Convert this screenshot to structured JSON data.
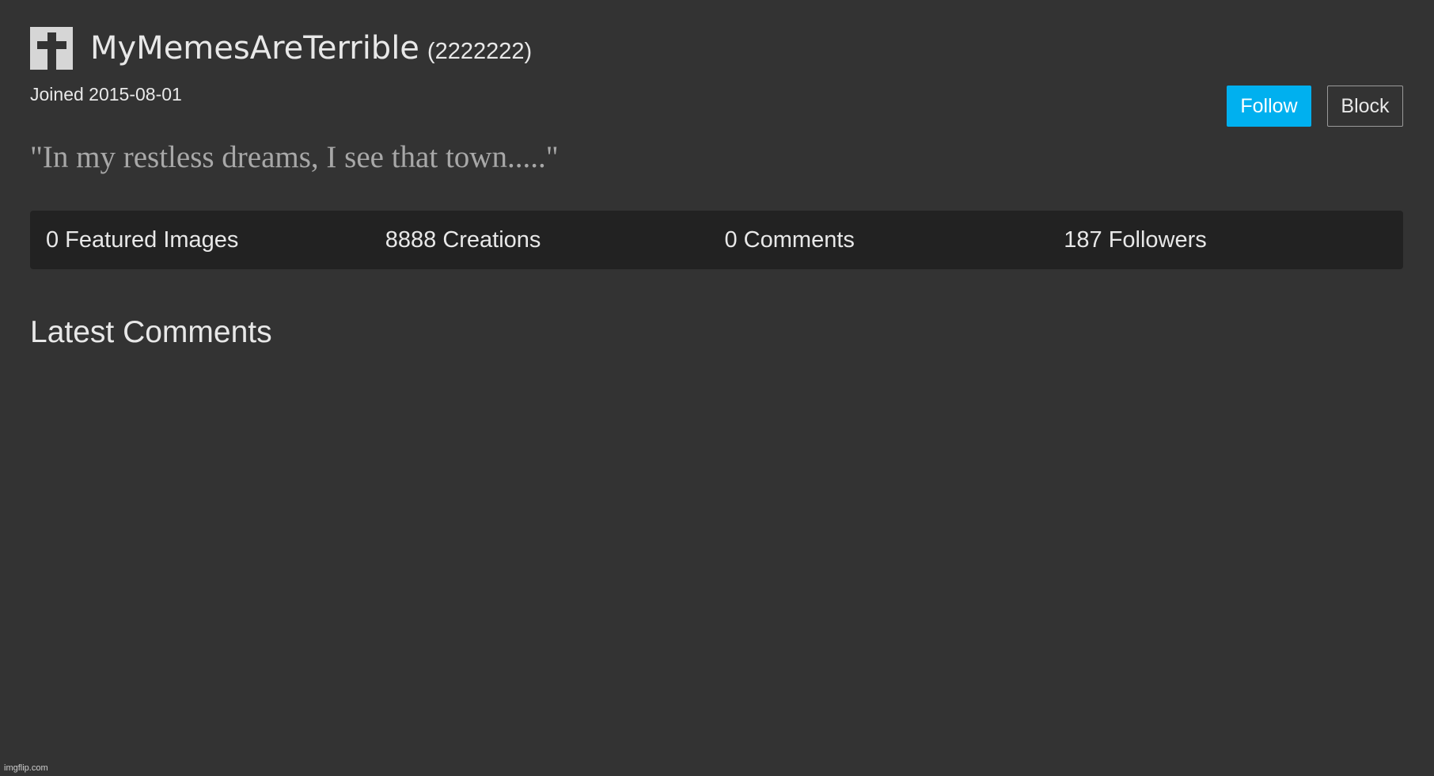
{
  "profile": {
    "username": "MyMemesAreTerrible",
    "points": "(2222222)",
    "joined": "Joined 2015-08-01",
    "quote": "\"In my restless dreams, I see that town.....\"",
    "avatar_icon": "cross-icon"
  },
  "actions": {
    "follow_label": "Follow",
    "block_label": "Block"
  },
  "stats": [
    {
      "label": "0 Featured Images"
    },
    {
      "label": "8888 Creations"
    },
    {
      "label": "0 Comments"
    },
    {
      "label": "187 Followers"
    }
  ],
  "sections": {
    "latest_comments_title": "Latest Comments"
  },
  "footer": {
    "brand": "imgflip.com"
  },
  "colors": {
    "background": "#333333",
    "stats_bar": "#222222",
    "accent": "#00b0ef",
    "quote_text": "#a8a8a8"
  }
}
